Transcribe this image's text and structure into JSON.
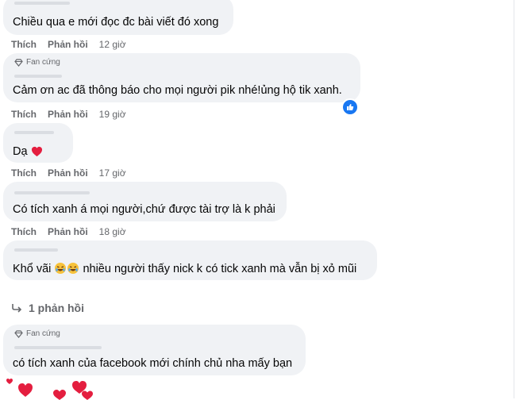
{
  "comments": [
    {
      "badge": "",
      "text": "Chiều qua e mới đọc đc bài viết đó xong",
      "like": "Thích",
      "reply": "Phản hồi",
      "time": "12 giờ"
    },
    {
      "badge": "Fan cứng",
      "text": "Cảm ơn ac đã thông báo cho mọi người pik nhé!ủng hộ tik xanh.",
      "like": "Thích",
      "reply": "Phản hồi",
      "time": "19 giờ"
    },
    {
      "badge": "",
      "text": "Dạ",
      "like": "Thích",
      "reply": "Phản hồi",
      "time": "17 giờ"
    },
    {
      "badge": "",
      "text": "Có tích xanh á mọi người,chứ được tài trợ là k phải",
      "like": "Thích",
      "reply": "Phản hồi",
      "time": "18 giờ"
    },
    {
      "badge": "",
      "text_before": "Khổ vãi",
      "text_after": "nhiều người thấy nick k có tick xanh mà vẫn bị xỏ mũi",
      "like": "Thích",
      "reply": "Phản hồi",
      "time": "18 giờ"
    },
    {
      "badge": "Fan cứng",
      "text": "có tích xanh của facebook mới chính chủ nha mấy bạn"
    }
  ],
  "replies_link": "1 phản hồi",
  "icons": {
    "badge": "diamond-icon",
    "reaction": "like-icon",
    "reply": "reply-arrow-icon",
    "hearts": "heart-icon"
  },
  "colors": {
    "bubble": "#f0f2f5",
    "meta": "#65676b",
    "like_blue": "#1877f2",
    "heart_red": "#e41e3f"
  }
}
